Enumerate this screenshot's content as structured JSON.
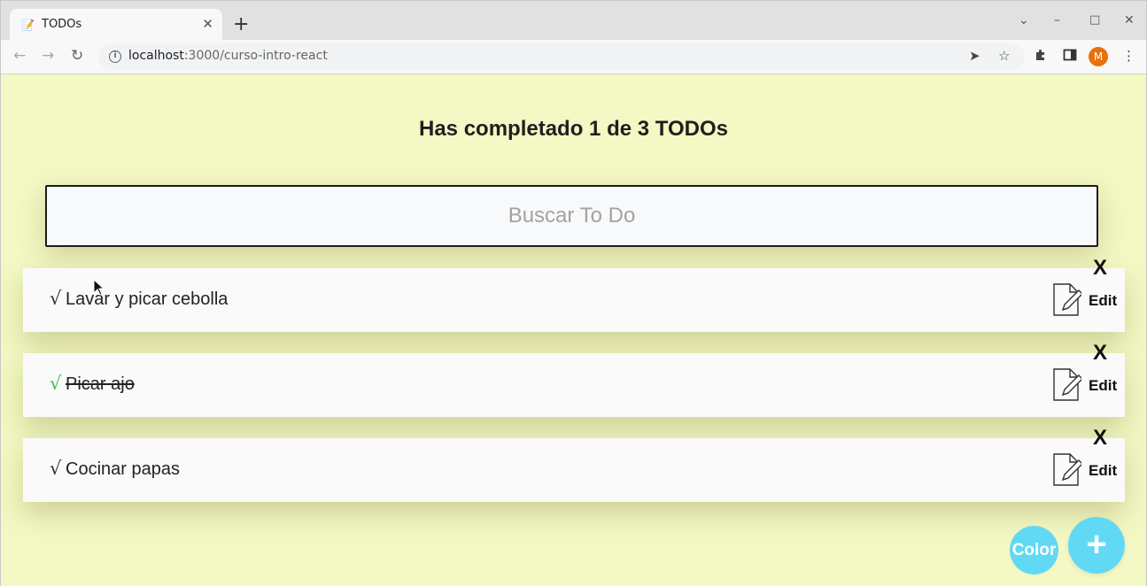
{
  "browser": {
    "tab_title": "TODOs",
    "tab_favicon": "📝",
    "url_host": "localhost",
    "url_rest": ":3000/curso-intro-react",
    "profile_initial": "M",
    "icons": {
      "back": "back-arrow-icon",
      "forward": "forward-arrow-icon",
      "reload": "reload-icon",
      "info": "info-icon",
      "send": "send-icon",
      "bookmark": "star-icon",
      "extensions": "puzzle-icon",
      "side_panel": "side-panel-icon",
      "menu": "kebab-menu-icon"
    }
  },
  "app": {
    "counter_text": "Has completado 1 de 3 TODOs",
    "search_placeholder": "Buscar To Do",
    "search_value": "",
    "check_symbol": "√",
    "delete_label": "X",
    "edit_label": "Edit",
    "color_button_label": "Color",
    "add_button_label": "+",
    "todos": [
      {
        "text": "Lavar y picar cebolla",
        "completed": false
      },
      {
        "text": "Picar ajo",
        "completed": true
      },
      {
        "text": "Cocinar papas",
        "completed": false
      }
    ]
  },
  "colors": {
    "page_background": "#f3f8c4",
    "check_done": "#3fbf4f",
    "fab": "#61d9f5"
  }
}
